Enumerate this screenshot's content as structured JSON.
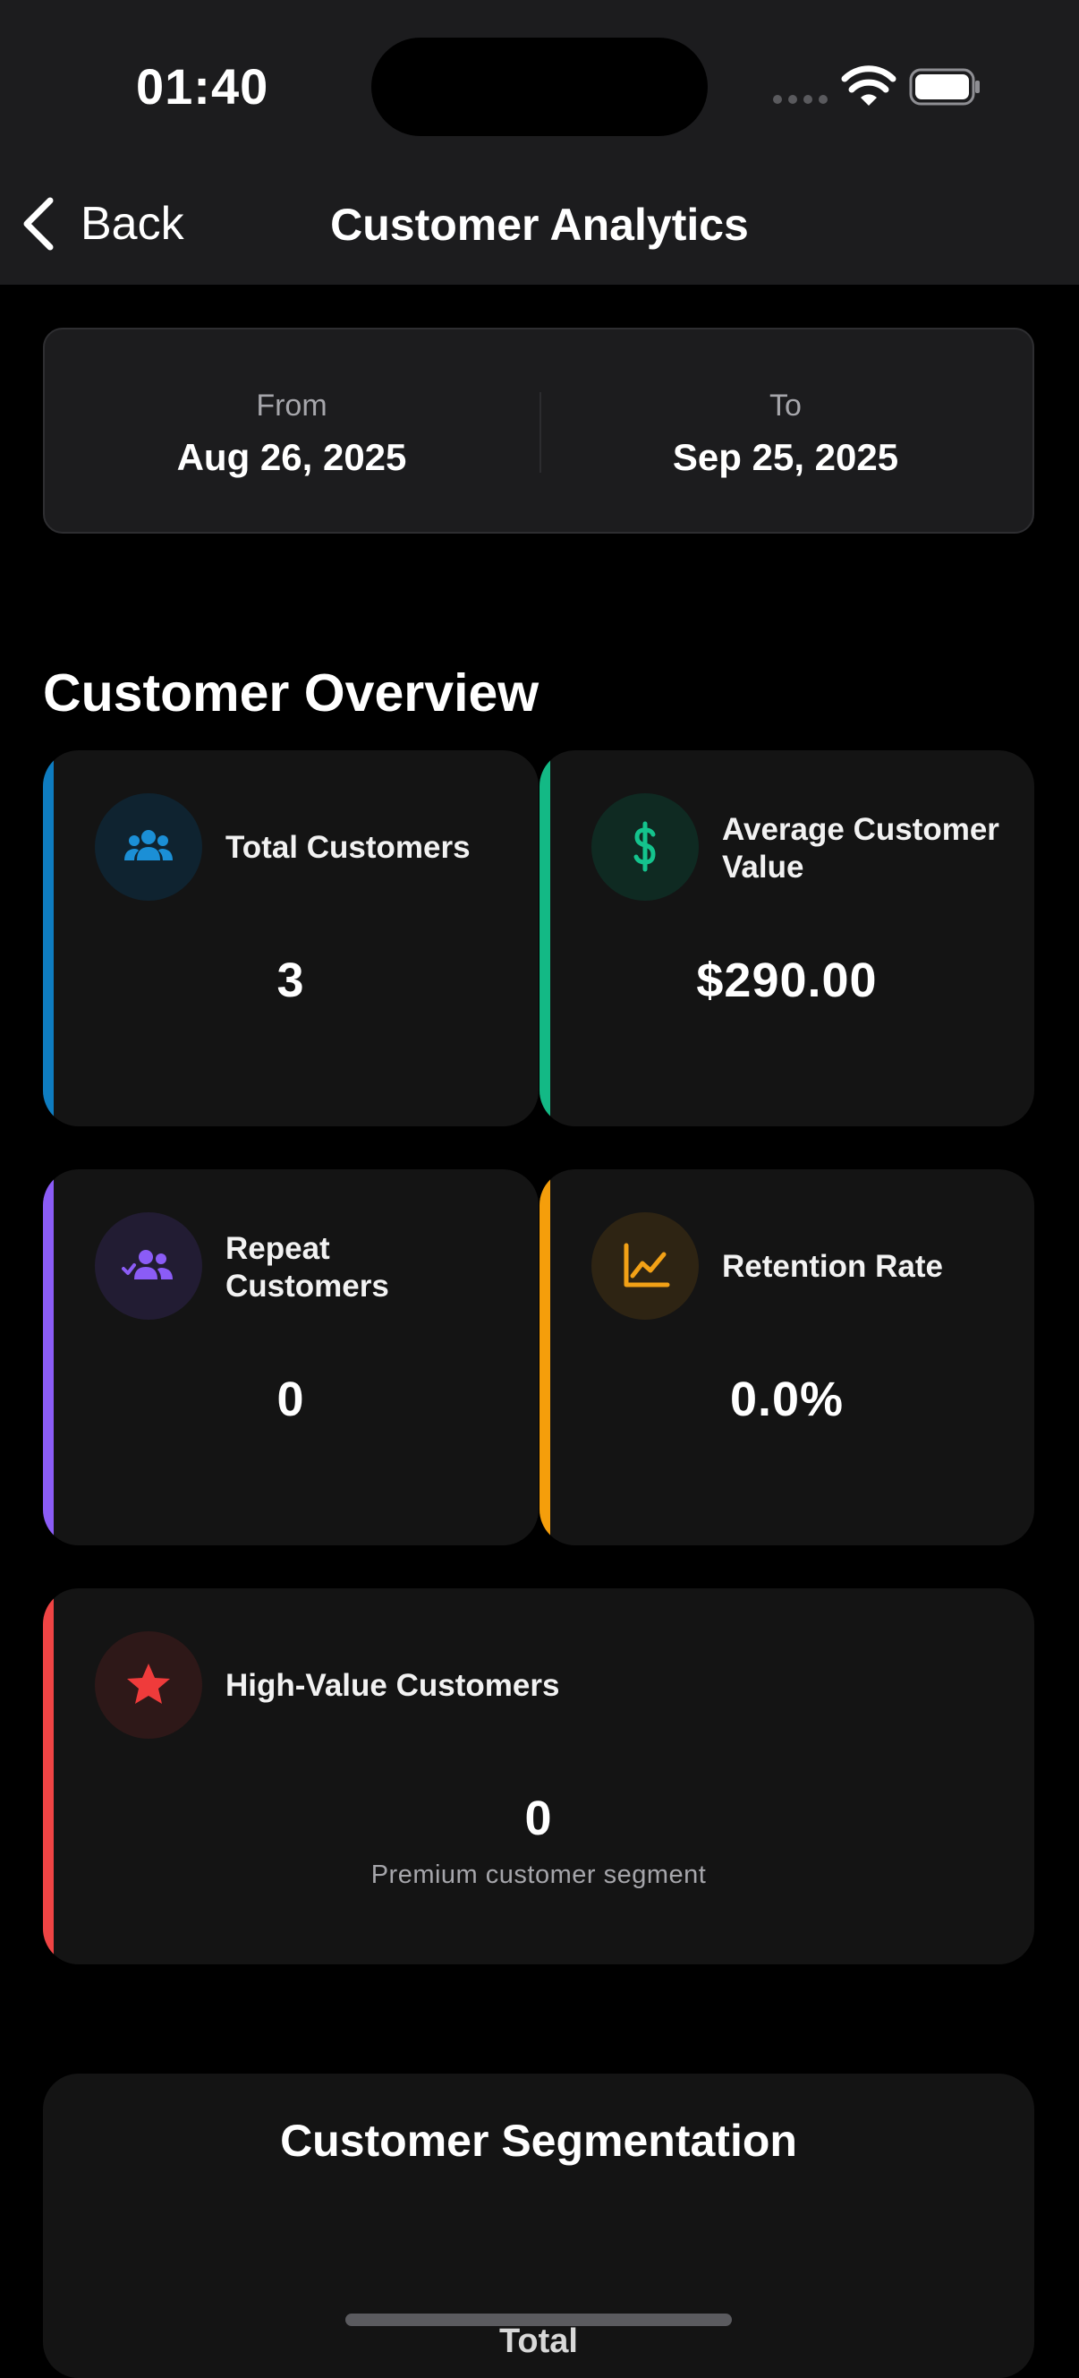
{
  "status_bar": {
    "time": "01:40"
  },
  "nav": {
    "back_label": "Back",
    "title": "Customer Analytics"
  },
  "date_range": {
    "from_label": "From",
    "from_value": "Aug 26, 2025",
    "to_label": "To",
    "to_value": "Sep 25, 2025"
  },
  "overview": {
    "title": "Customer Overview",
    "cards": [
      {
        "label": "Total Customers",
        "value": "3",
        "icon": "users-icon",
        "accent": "#0e7cc0"
      },
      {
        "label": "Average Customer Value",
        "value": "$290.00",
        "icon": "dollar-icon",
        "accent": "#13b985"
      },
      {
        "label": "Repeat Customers",
        "value": "0",
        "icon": "user-check-icon",
        "accent": "#8b5cf6"
      },
      {
        "label": "Retention Rate",
        "value": "0.0%",
        "icon": "line-chart-icon",
        "accent": "#f59e0b"
      },
      {
        "label": "High-Value Customers",
        "value": "0",
        "subtitle": "Premium customer segment",
        "icon": "star-icon",
        "accent": "#ef4444"
      }
    ]
  },
  "segmentation": {
    "title": "Customer Segmentation",
    "partial_label": "Total"
  }
}
